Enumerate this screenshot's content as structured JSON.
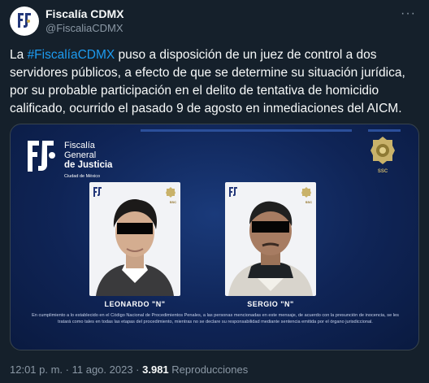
{
  "author": {
    "display_name": "Fiscalía CDMX",
    "handle": "@FiscaliaCDMX"
  },
  "tweet": {
    "text_before": "La ",
    "hashtag": "#FiscalíaCDMX",
    "text_after": " puso a disposición de un juez de control a dos servidores públicos, a efecto de que se determine su situación jurídica, por su probable participación en el delito de tentativa de homicidio calificado, ocurrido el pasado 9 de agosto en inmediaciones del AICM."
  },
  "media": {
    "org_line1": "Fiscalía",
    "org_line2": "General",
    "org_line3_prefix": "de ",
    "org_line3_bold": "Justicia",
    "org_line4": "Ciudad de México",
    "ssc_label": "SSC",
    "persons": [
      {
        "name": "LEONARDO \"N\""
      },
      {
        "name": "SERGIO \"N\""
      }
    ],
    "disclaimer": "En cumplimiento a lo establecido en el Código Nacional de Procedimientos Penales, a las personas mencionadas en este mensaje, de acuerdo con la presunción de inocencia, se les tratará como tales en todas las etapas del procedimiento, mientras no se declare su responsabilidad mediante sentencia emitida por el órgano jurisdiccional."
  },
  "meta": {
    "time": "12:01 p. m.",
    "separator": " · ",
    "date": "11 ago. 2023",
    "views_count": "3.981",
    "views_label": " Reproducciones"
  },
  "colors": {
    "background": "#15202b",
    "link": "#1d9bf0",
    "secondary_text": "#8b98a5",
    "media_blue": "#0f2456"
  }
}
